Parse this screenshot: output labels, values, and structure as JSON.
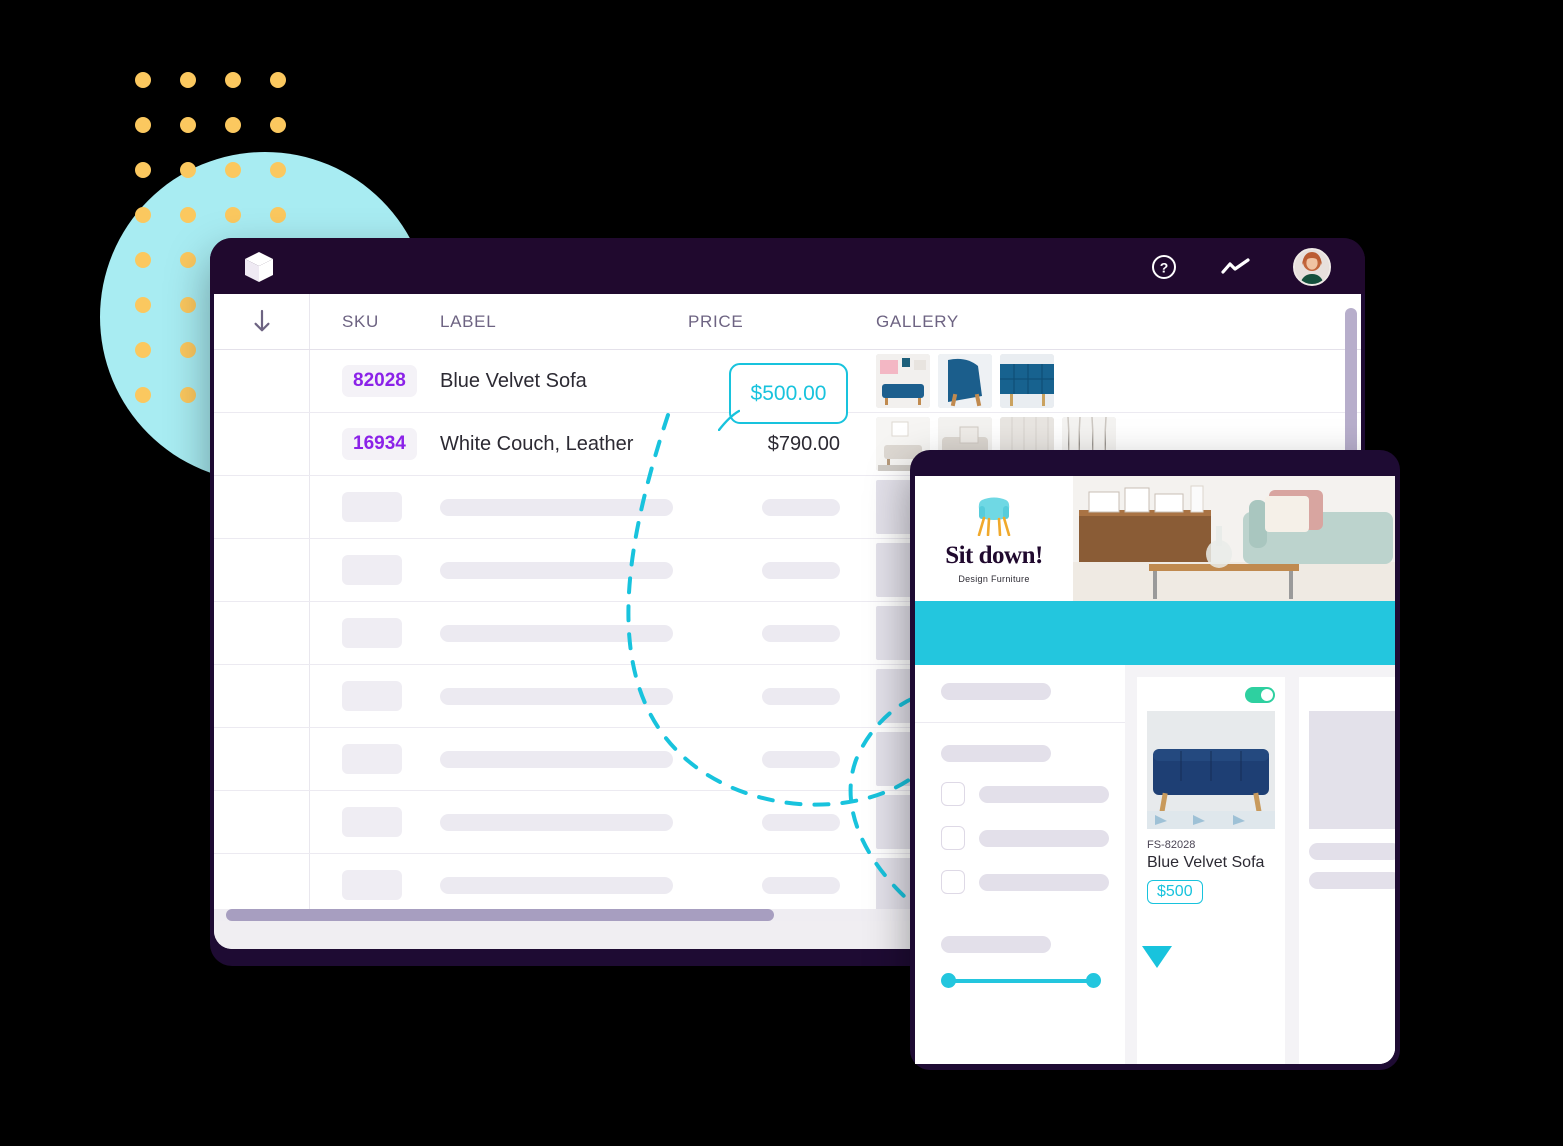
{
  "app": {
    "header": {
      "logo_icon": "cube-icon",
      "help_icon": "question-circle-icon",
      "analytics_icon": "trend-line-icon",
      "avatar_icon": "user-avatar"
    },
    "table": {
      "columns": [
        "SKU",
        "LABEL",
        "PRICE",
        "GALLERY"
      ],
      "sort_icon": "arrow-down-icon",
      "rows": [
        {
          "sku": "82028",
          "label": "Blue Velvet Sofa",
          "price": "$500.00",
          "price_highlighted": true,
          "gallery_count": 3
        },
        {
          "sku": "16934",
          "label": "White Couch, Leather",
          "price": "$790.00",
          "price_highlighted": false,
          "gallery_count": 4
        }
      ],
      "skeleton_row_count": 8
    },
    "scrollbars": {
      "horizontal": true,
      "vertical": true
    }
  },
  "overlay": {
    "brand": {
      "name": "Sit down!",
      "tagline": "Design Furniture",
      "logo_icon": "armchair-icon"
    },
    "hero_icon": "living-room-photo",
    "nav_color": "#23c6de",
    "sidebar": {
      "checkbox_count": 3,
      "slider_icon": "range-slider"
    },
    "cards": [
      {
        "sku": "FS-82028",
        "name": "Blue Velvet Sofa",
        "price": "$500",
        "toggle": "on",
        "image_icon": "blue-sofa-photo"
      },
      {
        "sku": "",
        "name": "",
        "price": "",
        "toggle": "off",
        "image_icon": "placeholder"
      }
    ]
  },
  "annotation": {
    "connector_color": "#18c3dd",
    "arrow_icon": "triangle-down-icon"
  },
  "decor": {
    "dot_color": "#fbc85f",
    "circle_color": "#a8ecf2",
    "dot_columns": 4,
    "dot_rows": 8
  },
  "colors": {
    "window_frame": "#20092e",
    "accent_cyan": "#18c3dd",
    "sku_purple": "#8b22e8",
    "toggle_on": "#2ed0a0"
  }
}
